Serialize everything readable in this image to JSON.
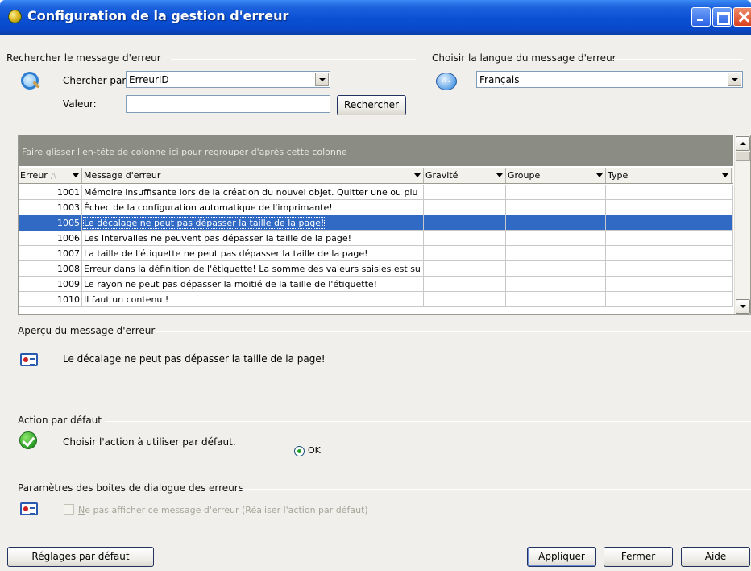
{
  "window": {
    "title": "Configuration de la gestion d'erreur"
  },
  "search": {
    "group_label": "Rechercher le message d'erreur",
    "search_by_label": "Chercher par:",
    "search_by_value": "ErreurID",
    "value_label": "Valeur:",
    "value_input": "",
    "search_button": "Rechercher"
  },
  "language": {
    "group_label": "Choisir la langue du message d'erreur",
    "selected": "Français"
  },
  "grid": {
    "group_panel_text": "Faire glisser l'en-tête de colonne ici pour regrouper d'après cette colonne",
    "columns": [
      "Erreur",
      "Message d'erreur",
      "Gravité",
      "Groupe",
      "Type"
    ],
    "rows": [
      {
        "id": "1001",
        "message": "Mémoire insuffisante lors de la création du nouvel objet. Quitter une ou plu",
        "severity": "",
        "group": "",
        "type": ""
      },
      {
        "id": "1003",
        "message": "Échec de la configuration automatique de l'imprimante!",
        "severity": "",
        "group": "",
        "type": ""
      },
      {
        "id": "1005",
        "message": "Le décalage ne peut pas dépasser la taille de la page!",
        "severity": "",
        "group": "",
        "type": ""
      },
      {
        "id": "1006",
        "message": "Les Intervalles ne peuvent pas dépasser la taille de la page!",
        "severity": "",
        "group": "",
        "type": ""
      },
      {
        "id": "1007",
        "message": "La taille de l'étiquette ne peut pas dépasser la taille de la page!",
        "severity": "",
        "group": "",
        "type": ""
      },
      {
        "id": "1008",
        "message": "Erreur dans la définition de l'étiquette! La somme des valeurs saisies est su",
        "severity": "",
        "group": "",
        "type": ""
      },
      {
        "id": "1009",
        "message": "Le rayon ne peut pas dépasser la moitié de la taille de l'étiquette!",
        "severity": "",
        "group": "",
        "type": ""
      },
      {
        "id": "1010",
        "message": "Il faut un contenu !",
        "severity": "",
        "group": "",
        "type": ""
      }
    ],
    "selected_row_id": "1005"
  },
  "preview": {
    "group_label": "Aperçu du  message d'erreur",
    "message": "Le décalage ne peut pas dépasser la taille de la page!"
  },
  "default_action": {
    "group_label": "Action par défaut",
    "description": "Choisir l'action à utiliser par défaut.",
    "option_ok": "OK"
  },
  "dialog_params": {
    "group_label": "Paramètres des boites de dialogue des erreurs",
    "checkbox_label_hotkey": "N",
    "checkbox_label_rest": "e pas afficher ce message d'erreur (Réaliser l'action par défaut)"
  },
  "buttons": {
    "defaults_hotkey": "R",
    "defaults_rest": "églages par défaut",
    "apply_hotkey": "A",
    "apply_rest": "ppliquer",
    "close_hotkey": "F",
    "close_rest": "ermer",
    "help_hotkey": "A",
    "help_rest": "ide"
  }
}
